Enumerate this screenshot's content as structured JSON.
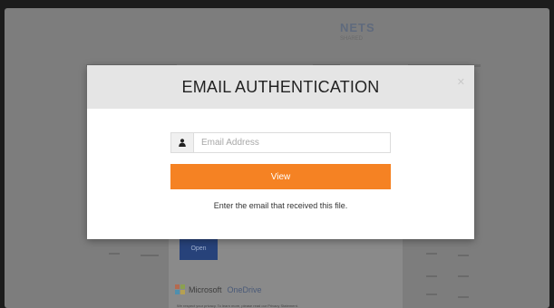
{
  "background": {
    "logo_text": "NETS",
    "logo_subtext": "SHARED",
    "open_button_label": "Open",
    "brand_name": "Microsoft",
    "product_name": "OneDrive",
    "fine_print": "We respect your privacy. To learn more, please read our Privacy Statement."
  },
  "modal": {
    "title": "EMAIL AUTHENTICATION",
    "close_icon": "close-icon",
    "email_icon": "user-icon",
    "email_placeholder": "Email Address",
    "email_value": "",
    "view_button_label": "View",
    "hint_text": "Enter the email that received this file."
  },
  "colors": {
    "accent": "#f58223",
    "header_bg": "#e5e5e5",
    "overlay": "#7d7d7d",
    "ms_red": "#f25022",
    "ms_green": "#7fba00",
    "ms_blue": "#00a4ef",
    "ms_yellow": "#ffb900"
  }
}
